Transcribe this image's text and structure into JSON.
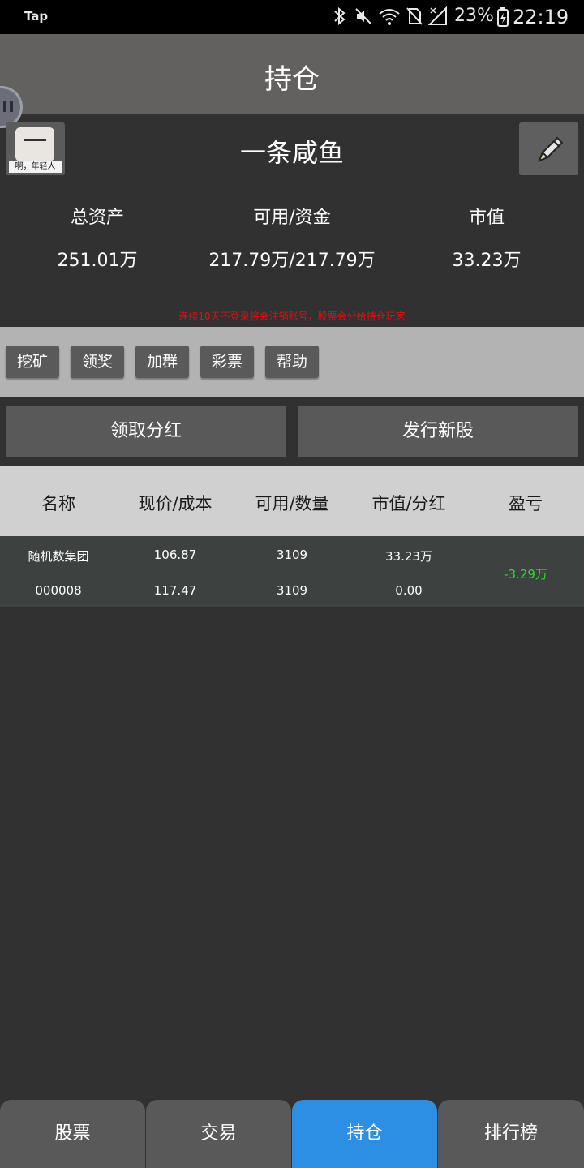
{
  "status_bar": {
    "app_name": "Tap",
    "battery_percent": "23%",
    "time": "22:19"
  },
  "header": {
    "title": "持仓"
  },
  "profile": {
    "avatar_caption": "啊，年轻人",
    "username": "一条咸鱼"
  },
  "stats": {
    "total_assets_label": "总资产",
    "total_assets_value": "251.01万",
    "available_label": "可用/资金",
    "available_value": "217.79万/217.79万",
    "market_value_label": "市值",
    "market_value_value": "33.23万"
  },
  "warning_text": "连续10天不登录将会注销账号，股票会分给持仓玩家",
  "tools": [
    "挖矿",
    "领奖",
    "加群",
    "彩票",
    "帮助"
  ],
  "actions": {
    "claim_dividend": "领取分红",
    "issue_new_stock": "发行新股"
  },
  "table": {
    "headers": [
      "名称",
      "现价/成本",
      "可用/数量",
      "市值/分红",
      "盈亏"
    ],
    "rows": [
      {
        "name": "随机数集团",
        "code": "000008",
        "price": "106.87",
        "cost": "117.47",
        "available": "3109",
        "quantity": "3109",
        "market_value": "33.23万",
        "dividend": "0.00",
        "profit_loss": "-3.29万"
      }
    ]
  },
  "tabs": [
    {
      "label": "股票",
      "active": false
    },
    {
      "label": "交易",
      "active": false
    },
    {
      "label": "持仓",
      "active": true
    },
    {
      "label": "排行榜",
      "active": false
    }
  ],
  "colors": {
    "background": "#313131",
    "header": "#636160",
    "active_tab": "#2d8fe4",
    "profit_loss": "#28e020",
    "warning": "#e01010"
  }
}
